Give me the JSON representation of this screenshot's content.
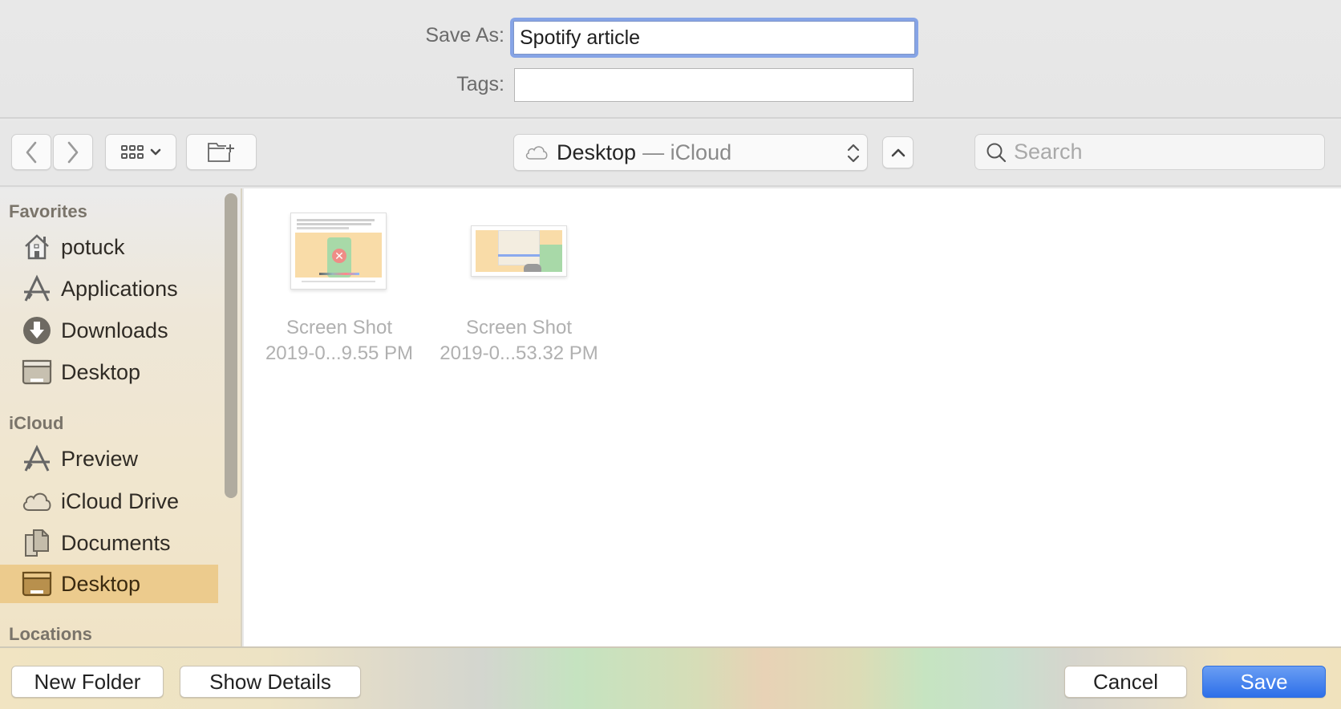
{
  "header": {
    "save_as_label": "Save As:",
    "save_as_value": "Spotify article",
    "tags_label": "Tags:",
    "tags_value": ""
  },
  "toolbar": {
    "back_icon": "chevron-left-icon",
    "forward_icon": "chevron-right-icon",
    "view_icon": "icon-grid-view-icon",
    "new_folder_icon": "new-folder-icon",
    "location": {
      "icon": "icloud-icon",
      "name": "Desktop",
      "separator_text": "— iCloud"
    },
    "parent_icon": "chevron-up-icon",
    "search": {
      "placeholder": "Search",
      "value": ""
    }
  },
  "sidebar": {
    "sections": [
      {
        "title": "Favorites",
        "items": [
          {
            "label": "potuck",
            "icon": "home-icon",
            "selected": false
          },
          {
            "label": "Applications",
            "icon": "applications-icon",
            "selected": false
          },
          {
            "label": "Downloads",
            "icon": "downloads-icon",
            "selected": false
          },
          {
            "label": "Desktop",
            "icon": "desktop-icon",
            "selected": false
          }
        ]
      },
      {
        "title": "iCloud",
        "items": [
          {
            "label": "Preview",
            "icon": "applications-icon",
            "selected": false
          },
          {
            "label": "iCloud Drive",
            "icon": "icloud-icon",
            "selected": false
          },
          {
            "label": "Documents",
            "icon": "documents-icon",
            "selected": false
          },
          {
            "label": "Desktop",
            "icon": "desktop-icon",
            "selected": true
          }
        ]
      },
      {
        "title": "Locations",
        "items": []
      }
    ]
  },
  "files": [
    {
      "name_line1": "Screen Shot",
      "name_line2": "2019-0...9.55 PM"
    },
    {
      "name_line1": "Screen Shot",
      "name_line2": "2019-0...53.32 PM"
    }
  ],
  "footer": {
    "new_folder_label": "New Folder",
    "show_details_label": "Show Details",
    "cancel_label": "Cancel",
    "save_label": "Save"
  },
  "colors": {
    "focus_ring": "#86a4e6",
    "selection": "#eccb8d",
    "primary_button": "#2d6fe9"
  }
}
